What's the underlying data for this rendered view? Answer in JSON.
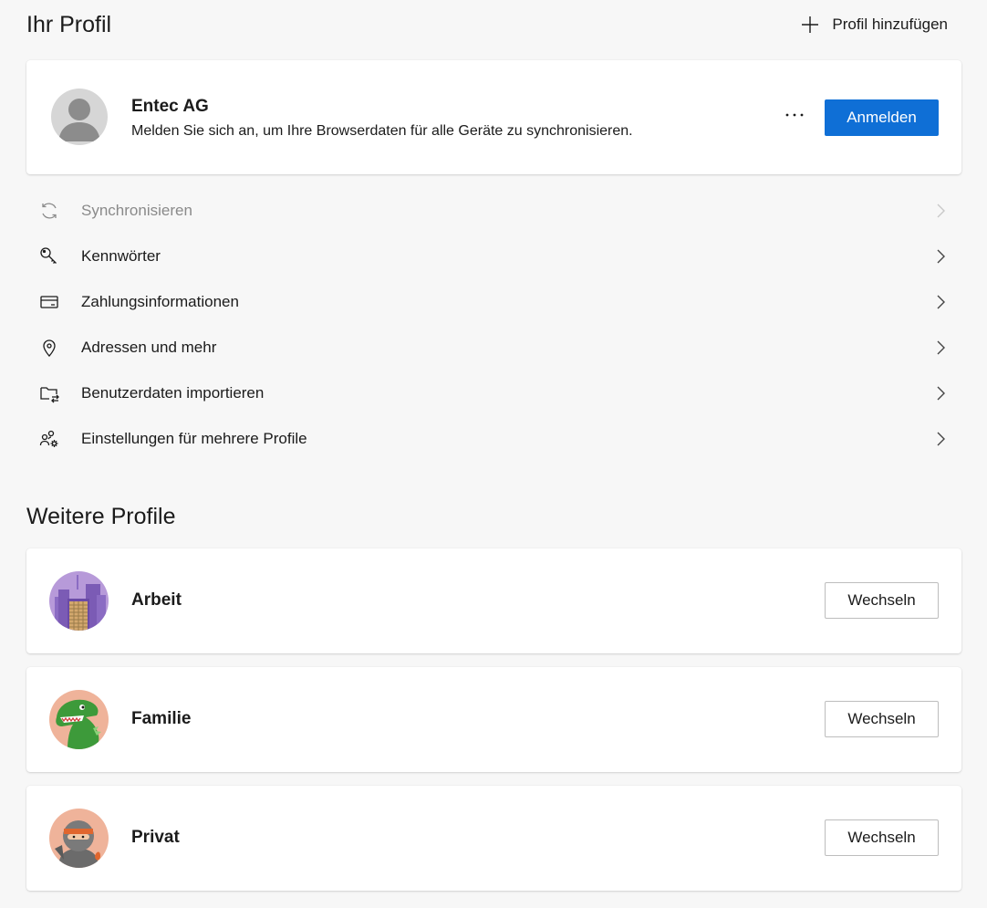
{
  "header": {
    "title": "Ihr Profil",
    "add_profile_label": "Profil hinzufügen",
    "add_icon": "plus-icon"
  },
  "current_profile": {
    "name": "Entec AG",
    "subtitle": "Melden Sie sich an, um Ihre Browserdaten für alle Geräte zu synchronisieren.",
    "more_label": "···",
    "signin_label": "Anmelden",
    "accent_color": "#0f6fd6"
  },
  "menu": [
    {
      "label": "Synchronisieren",
      "icon": "sync-icon",
      "disabled": true
    },
    {
      "label": "Kennwörter",
      "icon": "key-icon",
      "disabled": false
    },
    {
      "label": "Zahlungsinformationen",
      "icon": "credit-card-icon",
      "disabled": false
    },
    {
      "label": "Adressen und mehr",
      "icon": "location-pin-icon",
      "disabled": false
    },
    {
      "label": "Benutzerdaten importieren",
      "icon": "folder-import-icon",
      "disabled": false
    },
    {
      "label": "Einstellungen für mehrere Profile",
      "icon": "people-settings-icon",
      "disabled": false
    }
  ],
  "other_profiles": {
    "title": "Weitere Profile",
    "items": [
      {
        "name": "Arbeit",
        "avatar": "city-avatar-icon",
        "switch_label": "Wechseln"
      },
      {
        "name": "Familie",
        "avatar": "dinosaur-avatar-icon",
        "switch_label": "Wechseln"
      },
      {
        "name": "Privat",
        "avatar": "ninja-avatar-icon",
        "switch_label": "Wechseln"
      }
    ]
  }
}
